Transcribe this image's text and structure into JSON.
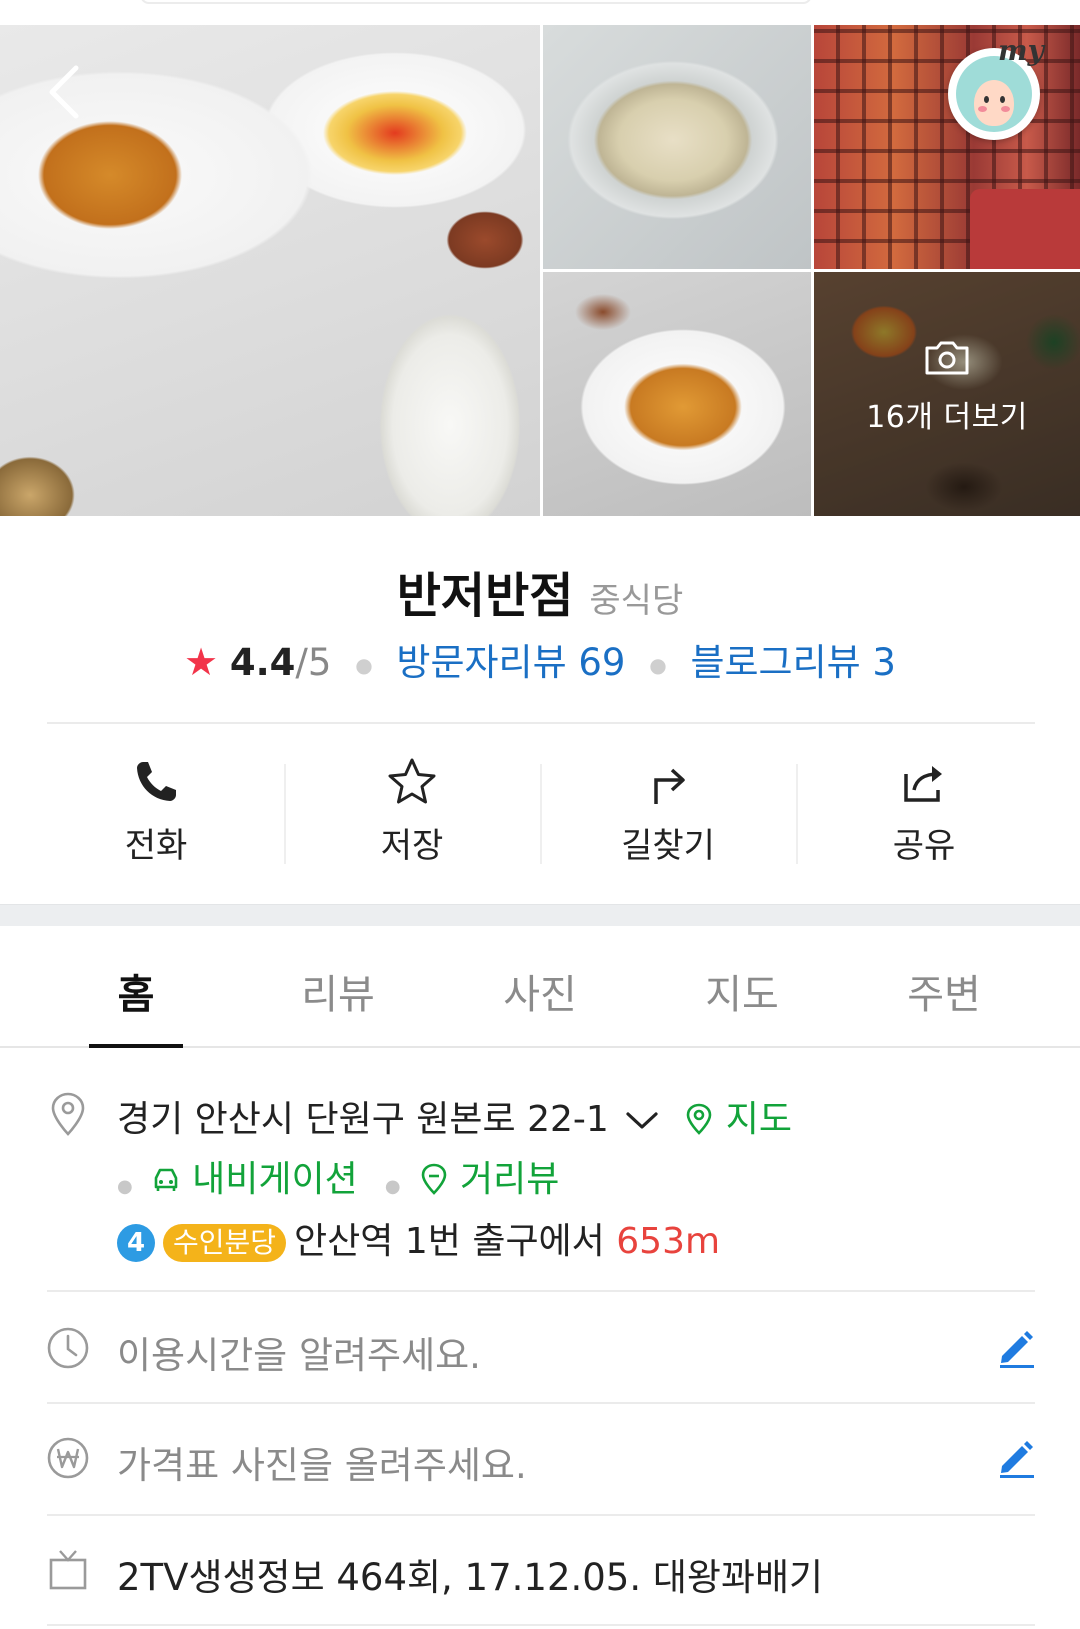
{
  "gallery": {
    "more_photos_label": "16개 더보기",
    "my_badge": "my"
  },
  "place": {
    "name": "반저반점",
    "category": "중식당",
    "rating": "4.4",
    "rating_max": "/5",
    "visitor_reviews": "방문자리뷰 69",
    "blog_reviews": "블로그리뷰 3"
  },
  "actions": [
    {
      "label": "전화",
      "icon": "phone-icon"
    },
    {
      "label": "저장",
      "icon": "star-outline-icon"
    },
    {
      "label": "길찾기",
      "icon": "directions-icon"
    },
    {
      "label": "공유",
      "icon": "share-icon"
    }
  ],
  "tabs": [
    "홈",
    "리뷰",
    "사진",
    "지도",
    "주변"
  ],
  "info": {
    "address": "경기 안산시 단원구 원본로 22-1",
    "map_link": "지도",
    "navigation_link": "내비게이션",
    "street_view_link": "거리뷰",
    "subway_line_number": "4",
    "subway_route": "수인분당",
    "subway_text": "안산역 1번 출구에서",
    "subway_distance": "653m",
    "hours_prompt": "이용시간을 알려주세요.",
    "price_prompt": "가격표 사진을 올려주세요.",
    "tv_info": "2TV생생정보 464회, 17.12.05. 대왕꽈배기"
  },
  "colors": {
    "link_blue": "#1a6fc4",
    "green": "#12a33a",
    "star_red": "#f2344a",
    "distance_red": "#e8433d",
    "subway_blue": "#2d9be3",
    "route_yellow": "#f4b31a",
    "edit_blue": "#1f7be0"
  }
}
